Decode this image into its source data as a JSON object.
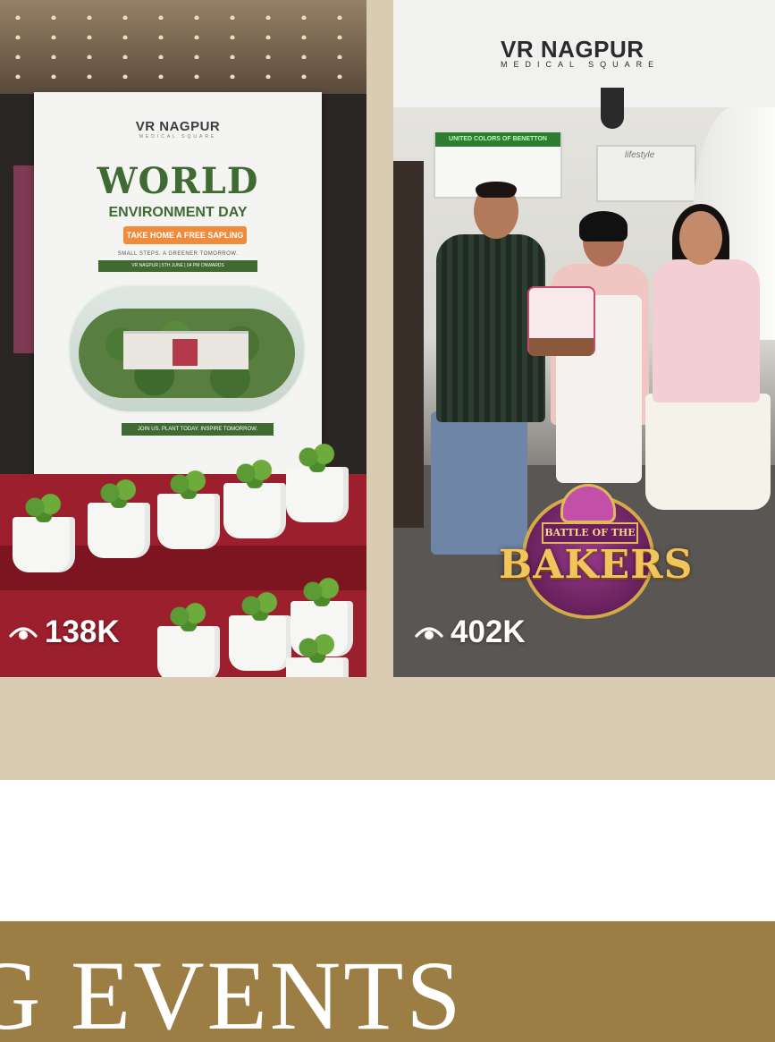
{
  "cards": [
    {
      "poster": {
        "logo": "VR NAGPUR",
        "logo_sub": "MEDICAL SQUARE",
        "title": "WORLD",
        "subtitle": "ENVIRONMENT DAY",
        "pill": "TAKE HOME A FREE SAPLING",
        "tagline": "SMALL STEPS. A GREENER TOMORROW.",
        "info": "VR NAGPUR | 5TH JUNE | 04 PM ONWARDS",
        "join": "JOIN US. PLANT TODAY. INSPIRE TOMORROW."
      },
      "views": "138K",
      "view_icon": "eye-icon"
    },
    {
      "mall_logo": "VR NAGPUR",
      "mall_logo_sub": "MEDICAL SQUARE",
      "store_sign_1": "UNITED COLORS OF BENETTON",
      "store_sign_2": "lifestyle",
      "event_badge": {
        "ribbon": "BATTLE OF THE",
        "word": "BAKERS"
      },
      "views": "402K",
      "view_icon": "eye-icon"
    }
  ],
  "banner": {
    "text": "G EVENTS"
  },
  "colors": {
    "band": "#d9ccb2",
    "banner": "#9c7d43",
    "banner_text": "#ffffff"
  }
}
